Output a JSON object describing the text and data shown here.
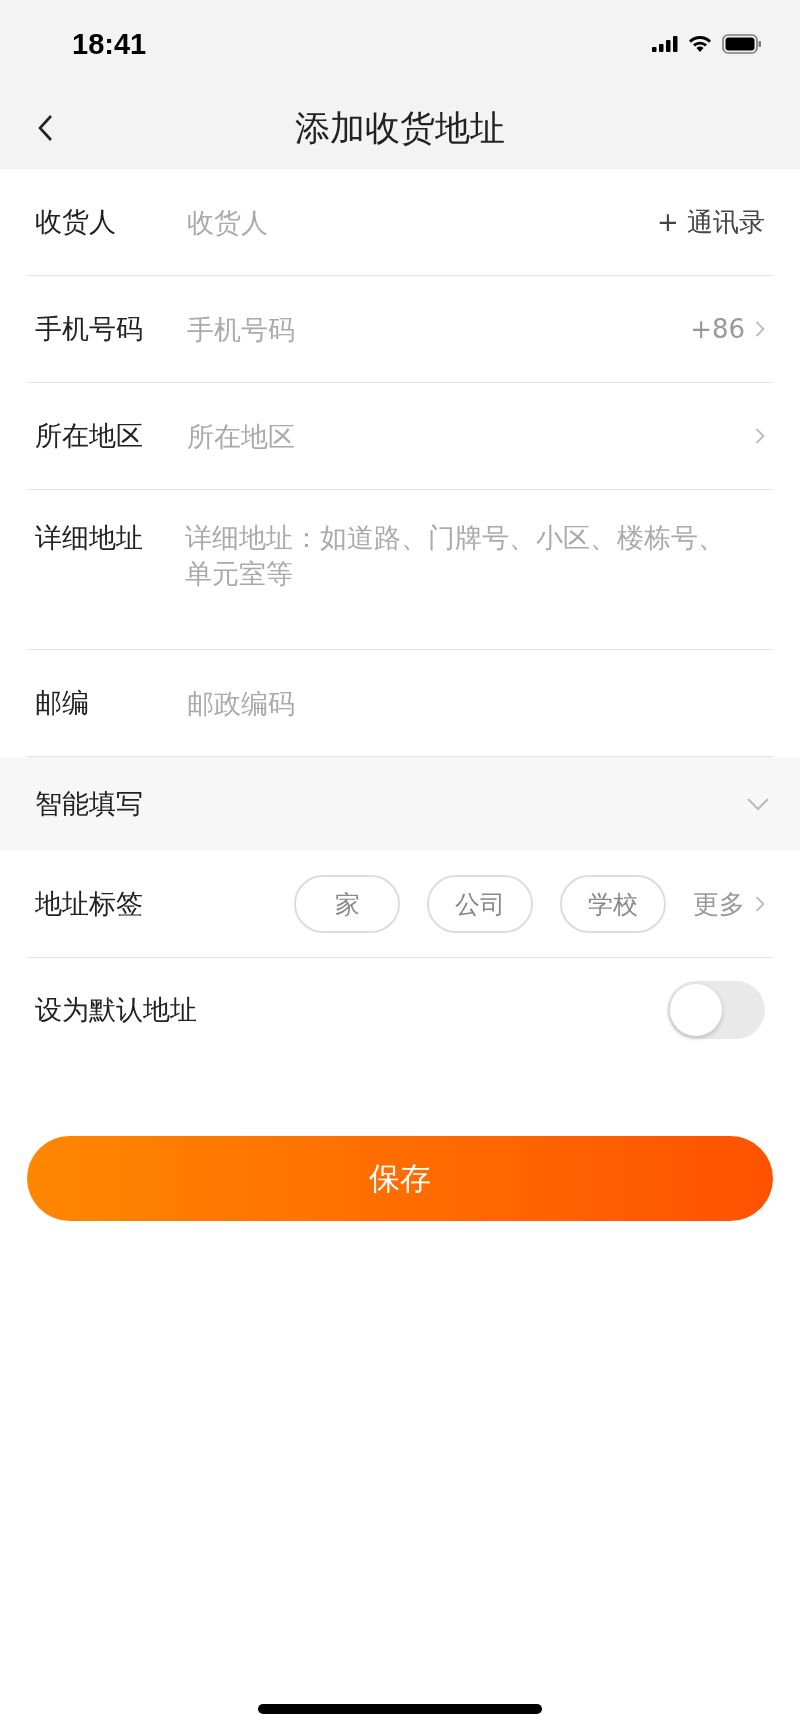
{
  "status_bar": {
    "time": "18:41"
  },
  "nav": {
    "title": "添加收货地址"
  },
  "fields": [
    {
      "kind": "input",
      "label": "收货人",
      "placeholder": "收货人",
      "accessory": "+ 通讯录",
      "chevron": false
    },
    {
      "kind": "input",
      "label": "手机号码",
      "placeholder": "手机号码",
      "accessory": "+86",
      "chevron": true
    },
    {
      "kind": "input",
      "label": "所在地区",
      "placeholder": "所在地区",
      "chevron": true
    },
    {
      "kind": "textarea",
      "label": "详细地址",
      "placeholder": "详细地址：如道路、门牌号、小区、楼栋号、单元室等",
      "chevron": false
    },
    {
      "kind": "input",
      "label": "邮编",
      "placeholder": "邮政编码",
      "chevron": false
    }
  ],
  "smart_fill": {
    "label": "智能填写",
    "expanded": false
  },
  "tags": {
    "label": "地址标签",
    "items": [
      {
        "label": "家",
        "selected": false
      },
      {
        "label": "公司",
        "selected": false
      },
      {
        "label": "学校",
        "selected": false
      }
    ],
    "more": "更多"
  },
  "default_address": {
    "label": "设为默认地址",
    "on": false
  },
  "save_button": "保存"
}
